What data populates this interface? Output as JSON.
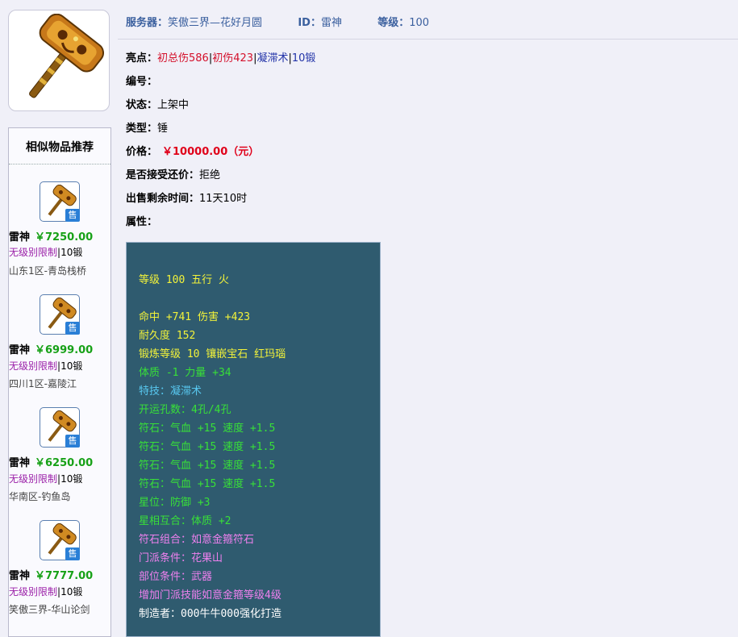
{
  "header": {
    "server_label": "服务器：",
    "server_value": "笑傲三界—花好月圆",
    "id_label": "ID：",
    "id_value": "雷神",
    "level_label": "等级：",
    "level_value": "100"
  },
  "fields": {
    "highlights_label": "亮点：",
    "highlights": [
      "初总伤586",
      "初伤423",
      "凝滞术",
      "10锻"
    ],
    "serial_label": "编号：",
    "status_label": "状态：",
    "status_value": "上架中",
    "type_label": "类型：",
    "type_value": "锤",
    "price_label": "价格：",
    "price_value": "￥10000.00（元）",
    "bargain_label": "是否接受还价：",
    "bargain_value": "拒绝",
    "time_label": "出售剩余时间：",
    "time_value": "11天10时",
    "attr_label": "属性："
  },
  "attributes": [
    {
      "text": "等级 100 五行 火",
      "color": "#f2f23a"
    },
    {
      "text": "命中 +741 伤害 +423",
      "color": "#f2f23a"
    },
    {
      "text": "耐久度 152",
      "color": "#f2f23a"
    },
    {
      "text": "锻炼等级 10 镶嵌宝石 红玛瑙",
      "color": "#f2f23a"
    },
    {
      "text": "体质 -1 力量 +34",
      "color": "#38e038"
    },
    {
      "text": "特技：凝滞术",
      "color": "#58c8f0"
    },
    {
      "text": "开运孔数：4孔/4孔",
      "color": "#38e038"
    },
    {
      "text": "符石：气血 +15 速度 +1.5",
      "color": "#38e038"
    },
    {
      "text": "符石：气血 +15 速度 +1.5",
      "color": "#38e038"
    },
    {
      "text": "符石：气血 +15 速度 +1.5",
      "color": "#38e038"
    },
    {
      "text": "符石：气血 +15 速度 +1.5",
      "color": "#38e038"
    },
    {
      "text": "星位：防御 +3",
      "color": "#38e038"
    },
    {
      "text": "星相互合：体质 +2",
      "color": "#38e038"
    },
    {
      "text": "符石组合：如意金箍符石",
      "color": "#ee80ee"
    },
    {
      "text": "门派条件：花果山",
      "color": "#ee80ee"
    },
    {
      "text": "部位条件：武器",
      "color": "#ee80ee"
    },
    {
      "text": "增加门派技能如意金箍等级4级",
      "color": "#ee80ee"
    },
    {
      "text": "制造者：000牛牛000强化打造",
      "color": "#ffffff"
    }
  ],
  "sidebar": {
    "title": "相似物品推荐",
    "sale_badge": "售",
    "items": [
      {
        "name": "雷神",
        "price": "￥7250.00",
        "limit": "无级别限制",
        "forge": "10锻",
        "server": "山东1区-青岛栈桥"
      },
      {
        "name": "雷神",
        "price": "￥6999.00",
        "limit": "无级别限制",
        "forge": "10锻",
        "server": "四川1区-嘉陵江"
      },
      {
        "name": "雷神",
        "price": "￥6250.00",
        "limit": "无级别限制",
        "forge": "10锻",
        "server": "华南区-钓鱼岛"
      },
      {
        "name": "雷神",
        "price": "￥7777.00",
        "limit": "无级别限制",
        "forge": "10锻",
        "server": "笑傲三界-华山论剑"
      }
    ]
  },
  "colors": {
    "highlight_red": "#d4102b",
    "highlight_blue": "#2233a8",
    "price_red": "#e0001a",
    "rec_price_green": "#17a117",
    "attr_box_bg": "#2f5b6f"
  },
  "icons": {
    "item_image": "hammer-weapon-icon",
    "rec_thumb": "hammer-thumbnail-icon"
  }
}
